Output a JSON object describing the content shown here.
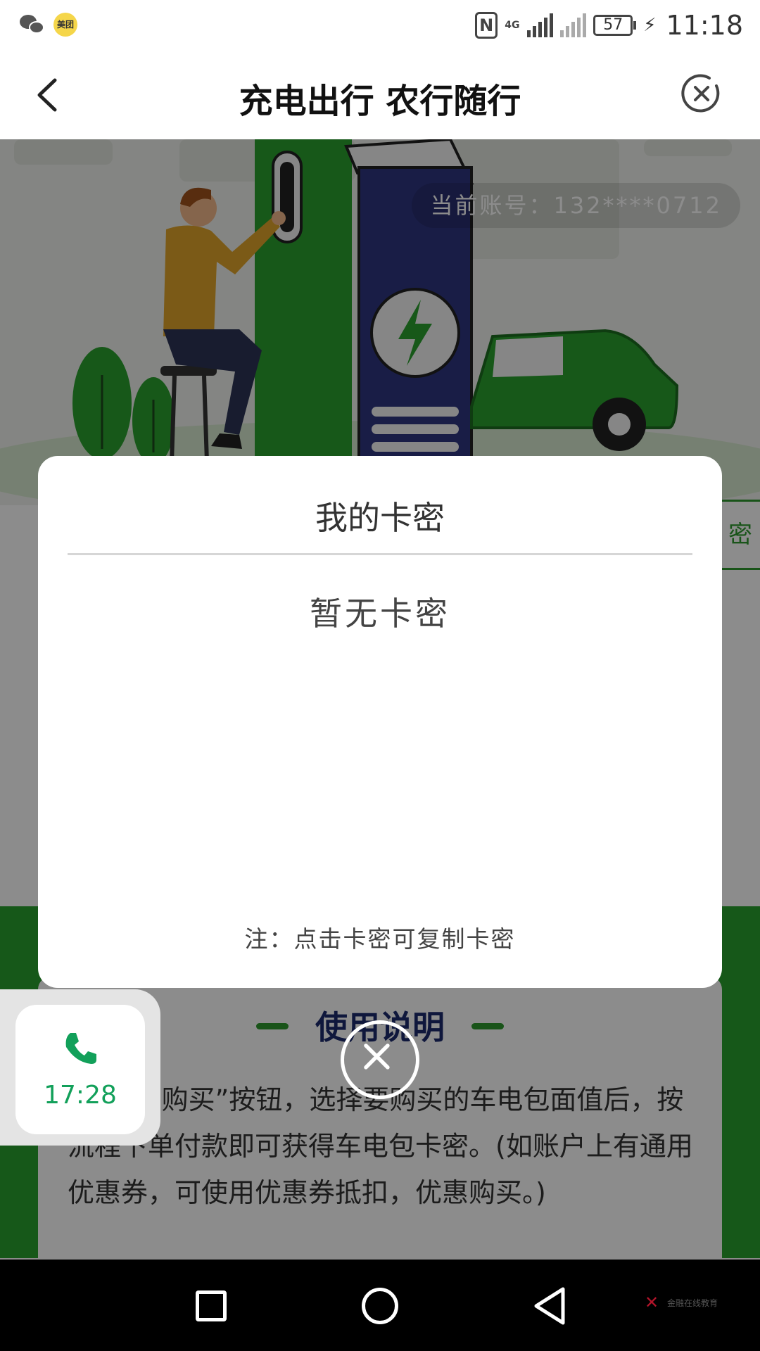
{
  "status_bar": {
    "meituan_badge": "美团",
    "network": "4G",
    "battery": "57",
    "time": "11:18"
  },
  "title_bar": {
    "title": "充电出行 农行随行"
  },
  "hero": {
    "account_label": "当前账号：132****0712"
  },
  "side_tab_partial": "密",
  "instructions": {
    "title": "使用说明",
    "text": "击“立即购买”按钮，选择要购买的车电包面值后，按流程下单付款即可获得车电包卡密。(如账户上有通用优惠券，可使用优惠券抵扣，优惠购买。)"
  },
  "modal": {
    "title": "我的卡密",
    "empty_text": "暂无卡密",
    "note": "注：点击卡密可复制卡密"
  },
  "call_widget": {
    "duration": "17:28"
  },
  "watermark": {
    "text": "金融在线教育"
  },
  "colors": {
    "brand_green": "#28a12f",
    "navy": "#1c2a6e",
    "call_green": "#12a05a"
  }
}
